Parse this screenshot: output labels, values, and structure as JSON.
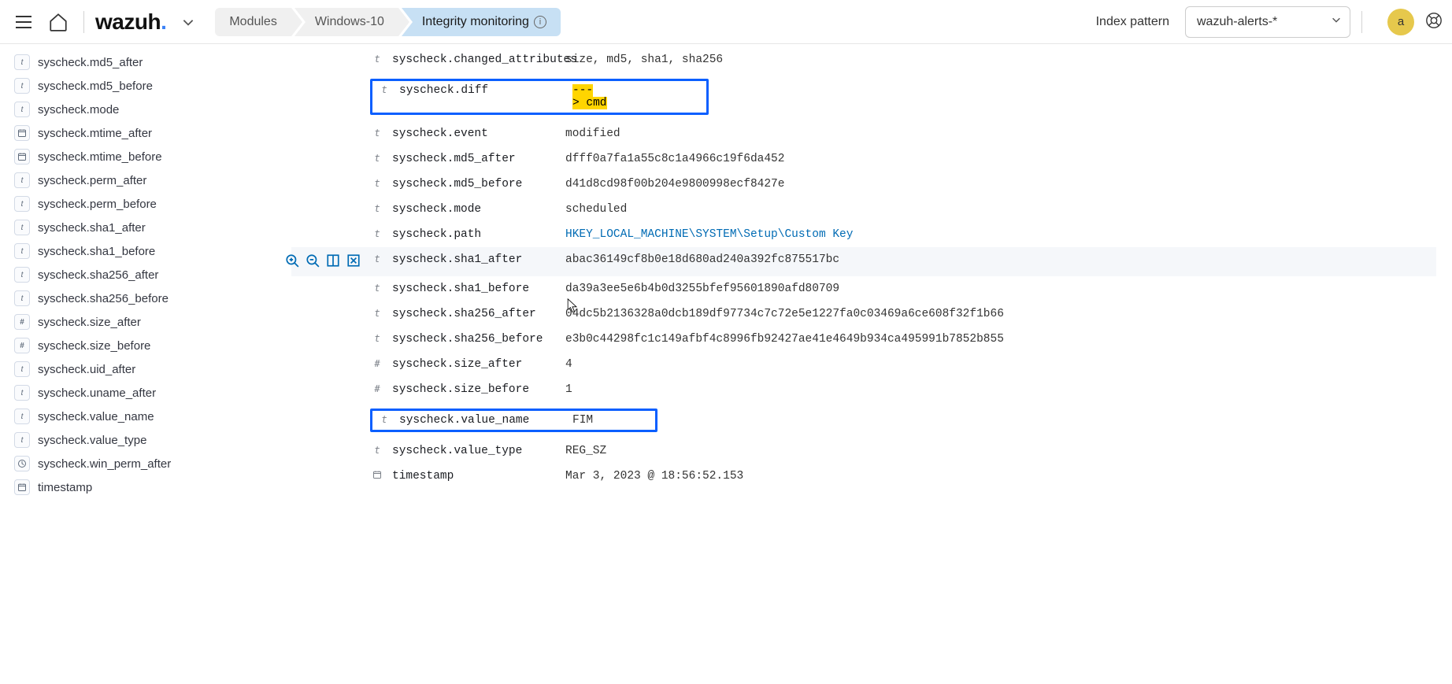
{
  "nav": {
    "logo_main": "wazuh",
    "logo_dot": ".",
    "breadcrumbs": [
      {
        "label": "Modules"
      },
      {
        "label": "Windows-10"
      },
      {
        "label": "Integrity monitoring",
        "active": true,
        "info": true
      }
    ],
    "index_pattern_label": "Index pattern",
    "index_pattern_value": "wazuh-alerts-*",
    "avatar_letter": "a"
  },
  "sidebar_fields": [
    {
      "type": "t",
      "name": "syscheck.md5_after"
    },
    {
      "type": "t",
      "name": "syscheck.md5_before"
    },
    {
      "type": "t",
      "name": "syscheck.mode"
    },
    {
      "type": "date",
      "name": "syscheck.mtime_after"
    },
    {
      "type": "date",
      "name": "syscheck.mtime_before"
    },
    {
      "type": "t",
      "name": "syscheck.perm_after"
    },
    {
      "type": "t",
      "name": "syscheck.perm_before"
    },
    {
      "type": "t",
      "name": "syscheck.sha1_after"
    },
    {
      "type": "t",
      "name": "syscheck.sha1_before"
    },
    {
      "type": "t",
      "name": "syscheck.sha256_after"
    },
    {
      "type": "t",
      "name": "syscheck.sha256_before"
    },
    {
      "type": "num",
      "name": "syscheck.size_after"
    },
    {
      "type": "num",
      "name": "syscheck.size_before"
    },
    {
      "type": "t",
      "name": "syscheck.uid_after"
    },
    {
      "type": "t",
      "name": "syscheck.uname_after"
    },
    {
      "type": "t",
      "name": "syscheck.value_name"
    },
    {
      "type": "t",
      "name": "syscheck.value_type"
    },
    {
      "type": "clock",
      "name": "syscheck.win_perm_after"
    },
    {
      "type": "date",
      "name": "timestamp"
    }
  ],
  "doc_fields": [
    {
      "glyph": "t",
      "key": "syscheck.changed_attributes",
      "val": "size, md5, sha1, sha256"
    },
    {
      "glyph": "t",
      "key": "syscheck.diff",
      "val_lines": [
        "---",
        "> cmd"
      ],
      "boxed": true,
      "yellow": true
    },
    {
      "glyph": "t",
      "key": "syscheck.event",
      "val": "modified"
    },
    {
      "glyph": "t",
      "key": "syscheck.md5_after",
      "val": "dfff0a7fa1a55c8c1a4966c19f6da452"
    },
    {
      "glyph": "t",
      "key": "syscheck.md5_before",
      "val": "d41d8cd98f00b204e9800998ecf8427e"
    },
    {
      "glyph": "t",
      "key": "syscheck.mode",
      "val": "scheduled"
    },
    {
      "glyph": "t",
      "key": "syscheck.path",
      "val": "HKEY_LOCAL_MACHINE\\SYSTEM\\Setup\\Custom Key",
      "link": true
    },
    {
      "glyph": "t",
      "key": "syscheck.sha1_after",
      "val": "abac36149cf8b0e18d680ad240a392fc875517bc",
      "hover": true
    },
    {
      "glyph": "t",
      "key": "syscheck.sha1_before",
      "val": "da39a3ee5e6b4b0d3255bfef95601890afd80709"
    },
    {
      "glyph": "t",
      "key": "syscheck.sha256_after",
      "val": "04dc5b2136328a0dcb189df97734c7c72e5e1227fa0c03469a6ce608f32f1b66"
    },
    {
      "glyph": "t",
      "key": "syscheck.sha256_before",
      "val": "e3b0c44298fc1c149afbf4c8996fb92427ae41e4649b934ca495991b7852b855"
    },
    {
      "glyph": "#",
      "key": "syscheck.size_after",
      "val": "4"
    },
    {
      "glyph": "#",
      "key": "syscheck.size_before",
      "val": "1"
    },
    {
      "glyph": "t",
      "key": "syscheck.value_name",
      "val": "FIM",
      "boxed": true
    },
    {
      "glyph": "t",
      "key": "syscheck.value_type",
      "val": "REG_SZ"
    },
    {
      "glyph": "date",
      "key": "timestamp",
      "val": "Mar 3, 2023 @ 18:56:52.153"
    }
  ]
}
